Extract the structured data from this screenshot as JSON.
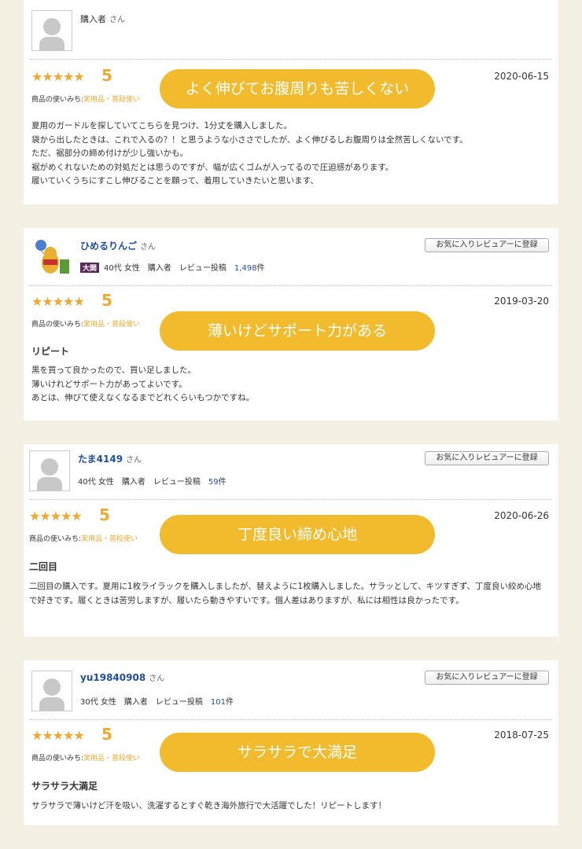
{
  "reviews": [
    {
      "username": "購入者",
      "san": "さん",
      "stars": "★★★★★",
      "score": "5",
      "usage_label": "商品の使いみち:",
      "usage_value": "実用品・普段使い",
      "date": "2020-06-15",
      "highlight": "よく伸びてお腹周りも苦しくない",
      "body": [
        "夏用のガードルを探していてこちらを見つけ、1分丈を購入しました。",
        "袋から出したときは、これで入るの？！と思うような小ささでしたが、よく伸びるしお腹周りは全然苦しくないです。",
        "ただ、裾部分の締め付けが少し強いかも。",
        "裾がめくれないための対処だとは思うのですが、幅が広くゴムが入ってるので圧迫感があります。",
        "履いていくうちにすこし伸びることを願って、着用していきたいと思います、"
      ]
    },
    {
      "username": "ひめるりんご",
      "san": "さん",
      "badge": "大関",
      "age_gender": "40代 女性",
      "buyer": "購入者",
      "review_posts_label": "レビュー投稿",
      "review_count": "1,498",
      "count_suffix": "件",
      "fav_button": "お気に入りレビュアーに登録",
      "stars": "★★★★★",
      "score": "5",
      "usage_label": "商品の使いみち:",
      "usage_value": "実用品・普段使い",
      "date": "2019-03-20",
      "highlight": "薄いけどサポート力がある",
      "title": "リピート",
      "body": [
        "黒を買って良かったので、買い足しました。",
        "薄いけれどサポート力があってよいです。",
        "あとは、伸びて使えなくなるまでどれくらいもつかですね。"
      ]
    },
    {
      "username": "たま4149",
      "san": "さん",
      "age_gender": "40代 女性",
      "buyer": "購入者",
      "review_posts_label": "レビュー投稿",
      "review_count": "59",
      "count_suffix": "件",
      "fav_button": "お気に入りレビュアーに登録",
      "stars": "★★★★★",
      "score": "5",
      "usage_label": "商品の使いみち:",
      "usage_value": "実用品・普段使い",
      "date": "2020-06-26",
      "highlight": "丁度良い締め心地",
      "title": "二回目",
      "body": [
        "二回目の購入です。夏用に1枚ライラックを購入しましたが、替えように1枚購入しました。サラッとして、キツすぎず、丁度良い絞め心地で好きです。履くときは苦労しますが、履いたら動きやすいです。個人差はありますが、私には相性は良かったです。"
      ]
    },
    {
      "username": "yu19840908",
      "san": "さん",
      "age_gender": "30代 女性",
      "buyer": "購入者",
      "review_posts_label": "レビュー投稿",
      "review_count": "101",
      "count_suffix": "件",
      "fav_button": "お気に入りレビュアーに登録",
      "stars": "★★★★★",
      "score": "5",
      "usage_label": "商品の使いみち:",
      "usage_value": "実用品・普段使い",
      "date": "2018-07-25",
      "highlight": "サラサラで大満足",
      "title": "サラサラ大満足",
      "body": [
        "サラサラで薄いけど汗を吸い、洗濯するとすぐ乾き海外旅行で大活躍でした！リピートします！"
      ]
    }
  ],
  "colors": {
    "star": "#f0a830",
    "pill": "#f2bb2e",
    "link": "#1f4fa0",
    "background": "#f5f0e4"
  }
}
